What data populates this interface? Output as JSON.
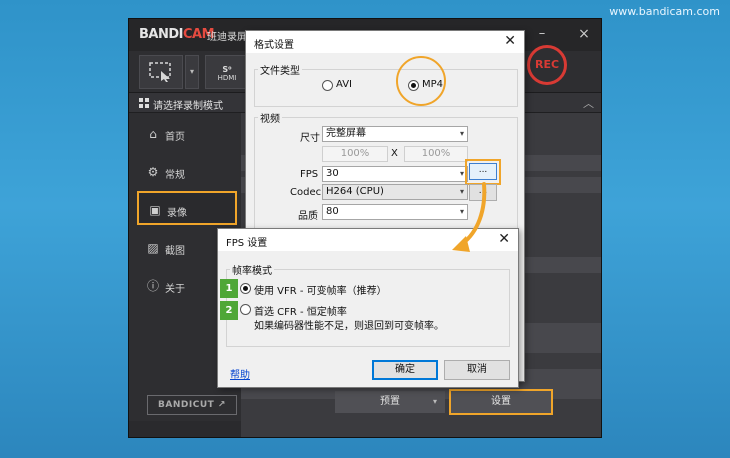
{
  "watermark": "www.bandicam.com",
  "main_window": {
    "logo_part1": "BANDI",
    "logo_part2": "CAM",
    "app_name": "班迪录屏",
    "minimize": "–",
    "close": "×",
    "toolbar": {
      "hdmi_top": "S⁰",
      "hdmi_label": "HDMI",
      "rec_label": "REC"
    },
    "header_title": "请选择录制模式",
    "sidebar": [
      {
        "label": "首页",
        "icon": "home-icon"
      },
      {
        "label": "常规",
        "icon": "gear-icon"
      },
      {
        "label": "录像",
        "icon": "video-gear-icon"
      },
      {
        "label": "截图",
        "icon": "image-icon"
      },
      {
        "label": "关于",
        "icon": "info-icon"
      }
    ],
    "bandicut_label": "BANDICUT ↗",
    "preset_label": "预置",
    "settings_label": "设置"
  },
  "format_dialog": {
    "title": "格式设置",
    "close": "✕",
    "file_type_group": "文件类型",
    "option_avi": "AVI",
    "option_mp4": "MP4",
    "selected_format": "MP4",
    "video_group": "视频",
    "size_label": "尺寸",
    "size_value": "完整屏幕",
    "scale_w": "100%",
    "scale_x": "X",
    "scale_h": "100%",
    "fps_label": "FPS",
    "fps_value": "30",
    "fps_more": "...",
    "codec_label": "Codec",
    "codec_value": "H264 (CPU)",
    "codec_more": "...",
    "quality_label": "品质",
    "quality_value": "80"
  },
  "fps_dialog": {
    "title": "FPS 设置",
    "close": "✕",
    "group_label": "帧率模式",
    "option_vfr": "使用 VFR - 可变帧率（推荐）",
    "option_cfr": "首选 CFR - 恒定帧率",
    "option_cfr_note": "如果编码器性能不足，则退回到可变帧率。",
    "selected": "vfr",
    "step1": "1",
    "step2": "2",
    "help": "帮助",
    "ok": "确定",
    "cancel": "取消"
  },
  "colors": {
    "highlight": "#f0a52a",
    "step_badge": "#4fa737",
    "rec_red": "#d83a34"
  }
}
